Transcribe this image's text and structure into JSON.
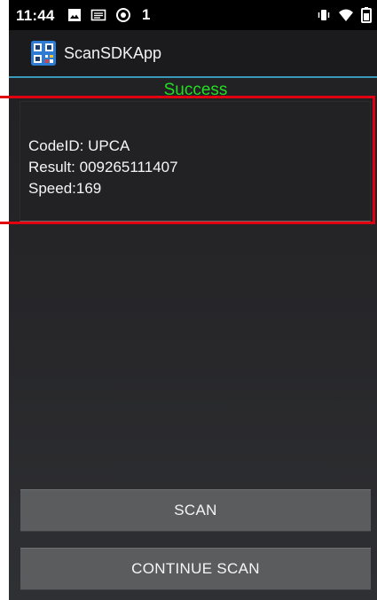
{
  "status_bar": {
    "time": "11:44",
    "notification_count": "1",
    "icons_left": [
      "image-icon",
      "screenshot-icon",
      "sync-icon"
    ],
    "icons_right": [
      "vibrate-icon",
      "wifi-icon",
      "battery-icon"
    ]
  },
  "app_bar": {
    "title": "ScanSDKApp",
    "icon": "qr-code-icon"
  },
  "scan_status": {
    "text": "Success",
    "color": "#22dd22"
  },
  "result": {
    "code_id": "CodeID: UPCA",
    "result": "Result: 009265111407",
    "speed": "Speed:169"
  },
  "buttons": {
    "scan_label": "SCAN",
    "continue_label": "CONTINUE SCAN"
  },
  "colors": {
    "highlight": "#e0000f",
    "accent_line": "#3a98b8"
  }
}
